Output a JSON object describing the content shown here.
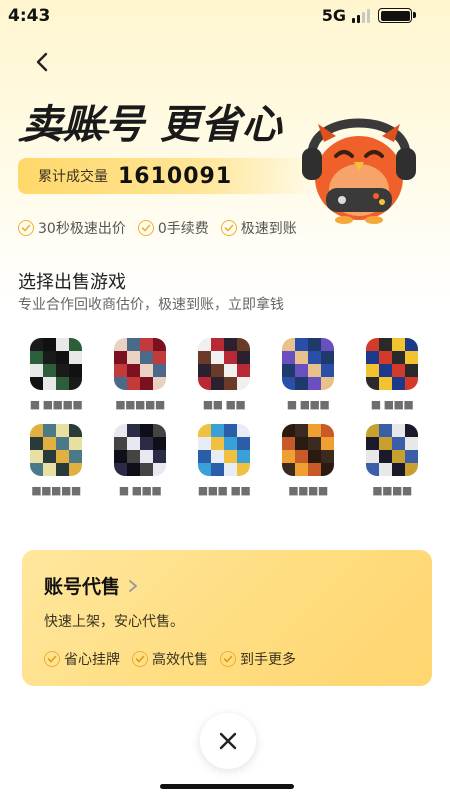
{
  "status_bar": {
    "time": "4:43",
    "network": "5G"
  },
  "hero": {
    "title": "卖账号 更省心",
    "trade_label": "累计成交量",
    "trade_value": "1610091"
  },
  "features": [
    "30秒极速出价",
    "0手续费",
    "极速到账"
  ],
  "section": {
    "title": "选择出售游戏",
    "subtitle": "专业合作回收商估价，极速到账，立即拿钱"
  },
  "games": [
    {
      "name": "■ ■■■■",
      "colors": [
        "#1a1a1a",
        "#2c5e3a",
        "#e8e8e8",
        "#111"
      ]
    },
    {
      "name": "■■■■■",
      "colors": [
        "#7a1020",
        "#c23a3a",
        "#4b6a8a",
        "#e9d2c2"
      ]
    },
    {
      "name": "■■ ■■",
      "colors": [
        "#2a2030",
        "#b72a35",
        "#f0f0f0",
        "#6b3b2a"
      ]
    },
    {
      "name": "■ ■■■",
      "colors": [
        "#2b4fa8",
        "#e8c28a",
        "#6a4fc0",
        "#1e3a6a"
      ]
    },
    {
      "name": "■ ■■■",
      "colors": [
        "#d23a2a",
        "#1d3a8a",
        "#f2c230",
        "#2a2a2a"
      ]
    },
    {
      "name": "■■■■■",
      "colors": [
        "#2a3a3a",
        "#e8e0a0",
        "#4a7a8a",
        "#e2b040"
      ]
    },
    {
      "name": "■ ■■■",
      "colors": [
        "#0f0f1a",
        "#2b2b45",
        "#e8e8f0",
        "#444"
      ]
    },
    {
      "name": "■■■ ■■",
      "colors": [
        "#3aa0d8",
        "#f0c040",
        "#e8ecf4",
        "#2a5ea8"
      ]
    },
    {
      "name": "■■■■",
      "colors": [
        "#2a1a10",
        "#c85a2a",
        "#f0a030",
        "#3a2a20"
      ]
    },
    {
      "name": "■■■■",
      "colors": [
        "#1a1a2a",
        "#e8e8e8",
        "#3a5ea8",
        "#c8a030"
      ]
    }
  ],
  "consign": {
    "title": "账号代售",
    "subtitle": "快速上架，安心代售。",
    "features": [
      "省心挂牌",
      "高效代售",
      "到手更多"
    ]
  },
  "colors": {
    "accent": "#f2ae2b",
    "card": "#ffdd80"
  }
}
